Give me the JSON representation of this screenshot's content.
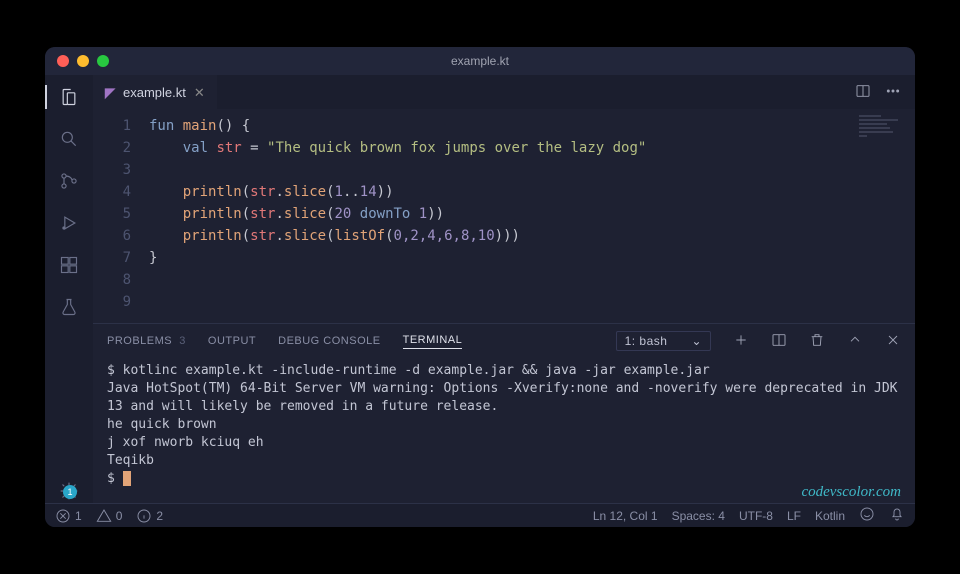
{
  "title": "example.kt",
  "tab": {
    "filename": "example.kt"
  },
  "activity": {
    "settings_badge": "1"
  },
  "editor": {
    "lines": [
      "1",
      "2",
      "3",
      "4",
      "5",
      "6",
      "7",
      "8",
      "9"
    ]
  },
  "code": {
    "l1": {
      "kw_fun": "fun",
      "fn": "main",
      "par": "()",
      "brace": " {"
    },
    "l2": {
      "kw_val": "val",
      "id": "str",
      "eq": " = ",
      "str": "\"The quick brown fox jumps over the lazy dog\""
    },
    "l4": {
      "fn": "println",
      "op1": "(",
      "id": "str",
      "dot": ".",
      "m": "slice",
      "op2": "(",
      "n1": "1",
      "rng": "..",
      "n2": "14",
      "cl": "))"
    },
    "l5": {
      "fn": "println",
      "op1": "(",
      "id": "str",
      "dot": ".",
      "m": "slice",
      "op2": "(",
      "n1": "20",
      "kw": " downTo ",
      "n2": "1",
      "cl": "))"
    },
    "l6": {
      "fn": "println",
      "op1": "(",
      "id": "str",
      "dot": ".",
      "m": "slice",
      "op2": "(",
      "fn2": "listOf",
      "op3": "(",
      "args": "0,2,4,6,8,10",
      "cl": ")))"
    },
    "l7": {
      "brace": "}"
    }
  },
  "panel": {
    "tabs": {
      "problems": "PROBLEMS",
      "problems_count": "3",
      "output": "OUTPUT",
      "debug": "DEBUG CONSOLE",
      "terminal": "TERMINAL"
    },
    "shell": "1: bash"
  },
  "terminal": {
    "prompt": "$ ",
    "cmd": "kotlinc example.kt -include-runtime -d example.jar && java -jar example.jar",
    "out1": "Java HotSpot(TM) 64-Bit Server VM warning: Options -Xverify:none and -noverify were deprecated in JDK 13 and will likely be removed in a future release.",
    "out2": "he quick brown",
    "out3": "j xof nworb kciuq eh",
    "out4": "Teqikb",
    "prompt2": "$ "
  },
  "watermark": "codevscolor.com",
  "status": {
    "errors": "1",
    "warnings": "0",
    "infos": "2",
    "pos": "Ln 12, Col 1",
    "spaces": "Spaces: 4",
    "enc": "UTF-8",
    "eol": "LF",
    "lang": "Kotlin"
  }
}
